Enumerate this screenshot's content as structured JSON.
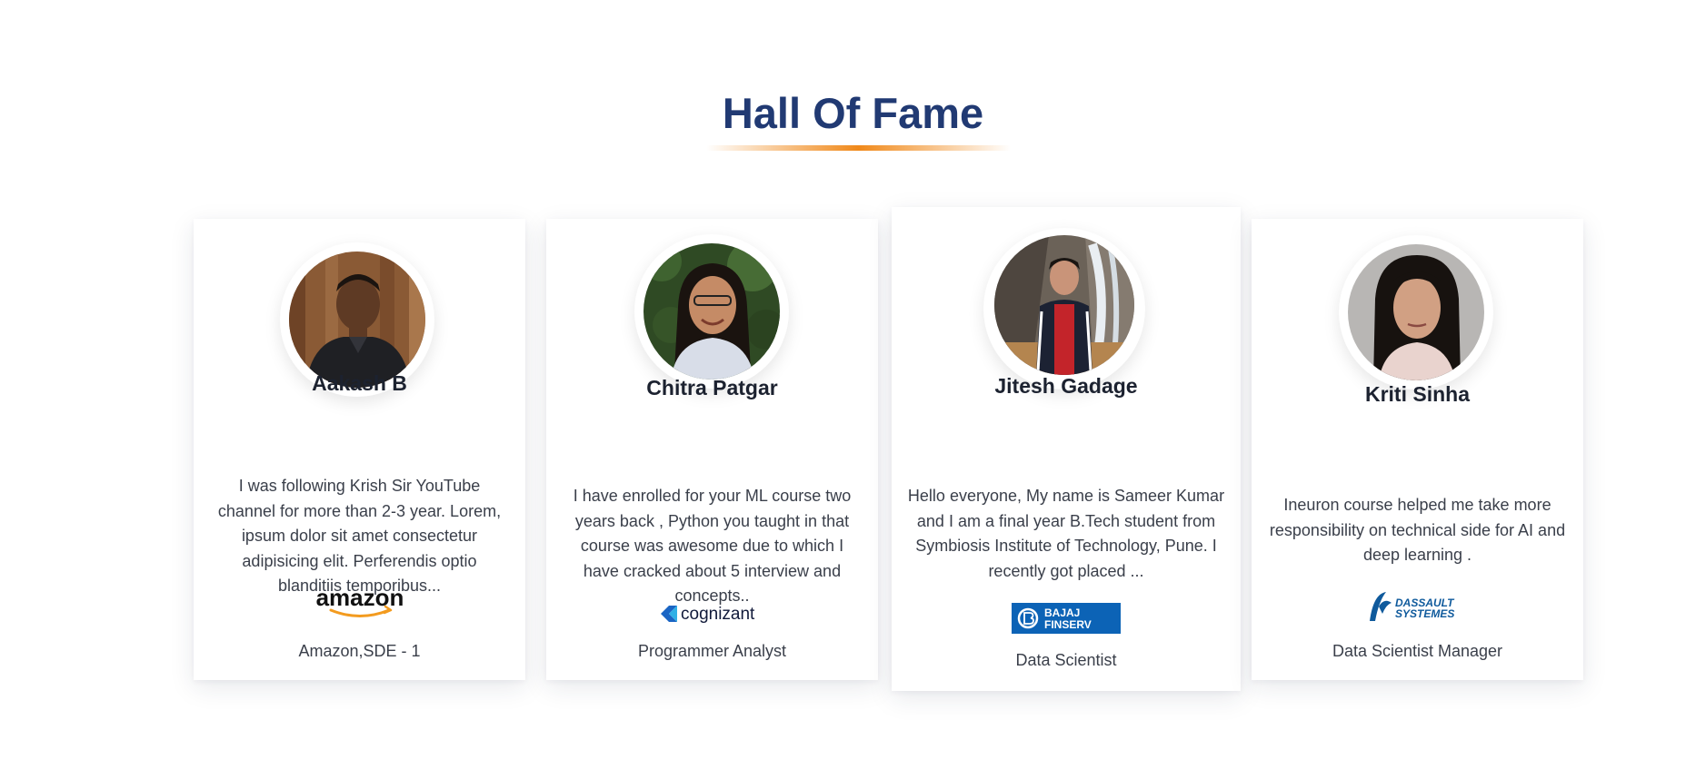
{
  "section": {
    "title": "Hall Of Fame",
    "title_color": "#213a73",
    "underline_color": "#f0891a"
  },
  "cards": [
    {
      "name": "Aakash B",
      "quote": "I was following Krish Sir YouTube channel for more than 2-3 year. Lorem, ipsum dolor sit amet consectetur adipisicing elit. Perferendis optio blanditiis temporibus...",
      "company_logo": "amazon",
      "company_logo_text": "amazon",
      "role": "Amazon,SDE - 1"
    },
    {
      "name": "Chitra Patgar",
      "quote": "I have enrolled for your ML course two years back , Python you taught in that course was awesome due to which I have cracked about 5 interview and concepts..",
      "company_logo": "cognizant",
      "company_logo_text": "cognizant",
      "role": "Programmer Analyst"
    },
    {
      "name": "Jitesh Gadage",
      "quote": "Hello everyone, My name is Sameer Kumar and I am a final year B.Tech student from Symbiosis Institute of Technology, Pune. I recently got placed ...",
      "company_logo": "bajaj-finserv",
      "company_logo_text": [
        "BAJAJ",
        "FINSERV"
      ],
      "role": "Data Scientist"
    },
    {
      "name": "Kriti Sinha",
      "quote": "Ineuron course helped me take more responsibility on technical side for AI and deep learning .",
      "company_logo": "dassault-systemes",
      "company_logo_text": [
        "DASSAULT",
        "SYSTEMES"
      ],
      "role": "Data Scientist Manager"
    }
  ]
}
